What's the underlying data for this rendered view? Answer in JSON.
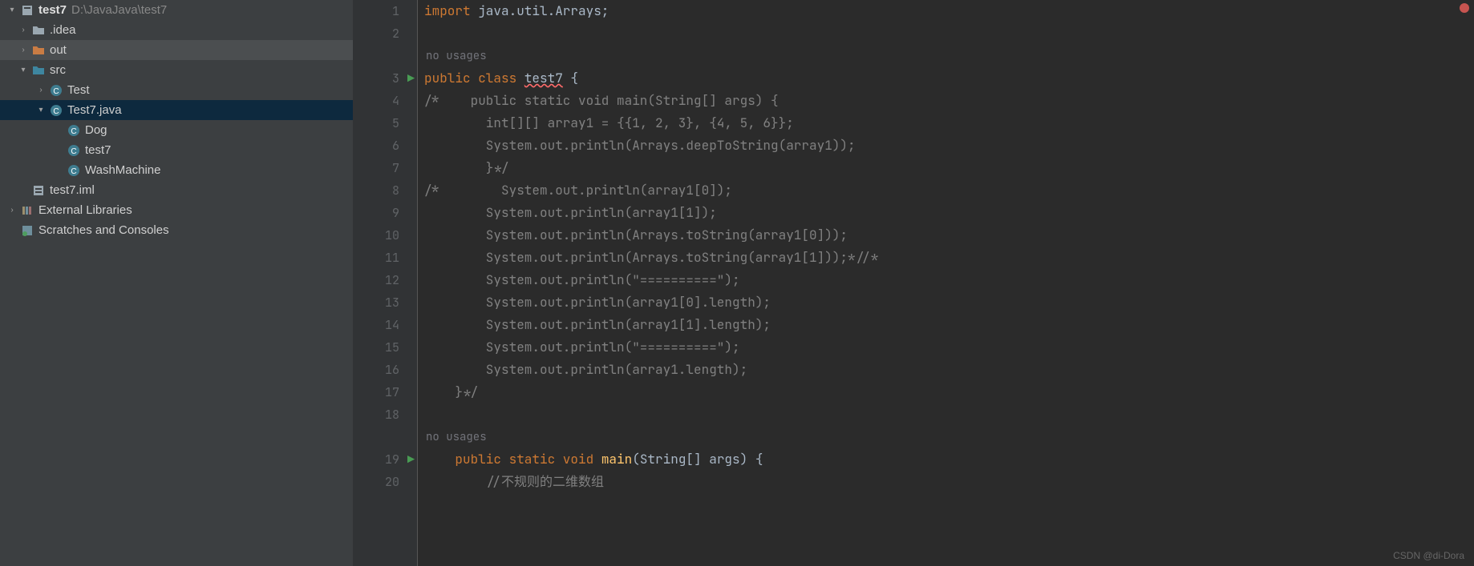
{
  "project": {
    "name": "test7",
    "path": "D:\\JavaJava\\test7",
    "tree": [
      {
        "indent": 0,
        "arrow": ">",
        "icon": "folder",
        "label": ".idea"
      },
      {
        "indent": 0,
        "arrow": ">",
        "icon": "folder-out",
        "label": "out",
        "highlighted": true
      },
      {
        "indent": 0,
        "arrow": "v",
        "icon": "folder-src",
        "label": "src",
        "err": true
      },
      {
        "indent": 1,
        "arrow": ">",
        "icon": "class",
        "label": "Test"
      },
      {
        "indent": 1,
        "arrow": "v",
        "icon": "class",
        "label": "Test7.java",
        "selected": true
      },
      {
        "indent": 2,
        "arrow": "",
        "icon": "class",
        "label": "Dog",
        "err": true
      },
      {
        "indent": 2,
        "arrow": "",
        "icon": "class",
        "label": "test7"
      },
      {
        "indent": 2,
        "arrow": "",
        "icon": "class",
        "label": "WashMachine",
        "err": true
      },
      {
        "indent": 0,
        "arrow": "",
        "icon": "iml",
        "label": "test7.iml"
      }
    ],
    "external": "External Libraries",
    "scratches": "Scratches and Consoles"
  },
  "hints": {
    "no_usages_1": "no usages",
    "no_usages_2": "no usages"
  },
  "code": {
    "lines": [
      {
        "n": 1,
        "tokens": [
          {
            "t": "import ",
            "c": "kw"
          },
          {
            "t": "java.util.Arrays;",
            "c": ""
          }
        ]
      },
      {
        "n": 2,
        "tokens": []
      },
      {
        "hint": "no_usages_1"
      },
      {
        "n": 3,
        "run": true,
        "tokens": [
          {
            "t": "public class ",
            "c": "kw"
          },
          {
            "t": "test7",
            "c": "err2"
          },
          {
            "t": " {",
            "c": ""
          }
        ]
      },
      {
        "n": 4,
        "tokens": [
          {
            "t": "/*    public static void main(String[] args) {",
            "c": "com"
          }
        ]
      },
      {
        "n": 5,
        "tokens": [
          {
            "t": "        int[][] array1 = {{1, 2, 3}, {4, 5, 6}};",
            "c": "com"
          }
        ]
      },
      {
        "n": 6,
        "tokens": [
          {
            "t": "        System.out.println(Arrays.deepToString(array1));",
            "c": "com"
          }
        ]
      },
      {
        "n": 7,
        "tokens": [
          {
            "t": "        }*/",
            "c": "com"
          }
        ]
      },
      {
        "n": 8,
        "tokens": [
          {
            "t": "/*        System.out.println(array1[0]);",
            "c": "com"
          }
        ]
      },
      {
        "n": 9,
        "tokens": [
          {
            "t": "        System.out.println(array1[1]);",
            "c": "com"
          }
        ]
      },
      {
        "n": 10,
        "tokens": [
          {
            "t": "        System.out.println(Arrays.toString(array1[0]));",
            "c": "com"
          }
        ]
      },
      {
        "n": 11,
        "tokens": [
          {
            "t": "        System.out.println(Arrays.toString(array1[1]));*//*",
            "c": "com"
          }
        ]
      },
      {
        "n": 12,
        "tokens": [
          {
            "t": "        System.out.println(\"==========\");",
            "c": "com"
          }
        ]
      },
      {
        "n": 13,
        "tokens": [
          {
            "t": "        System.out.println(array1[0].length);",
            "c": "com"
          }
        ]
      },
      {
        "n": 14,
        "tokens": [
          {
            "t": "        System.out.println(array1[1].length);",
            "c": "com"
          }
        ]
      },
      {
        "n": 15,
        "tokens": [
          {
            "t": "        System.out.println(\"==========\");",
            "c": "com"
          }
        ]
      },
      {
        "n": 16,
        "tokens": [
          {
            "t": "        System.out.println(array1.length);",
            "c": "com"
          }
        ]
      },
      {
        "n": 17,
        "tokens": [
          {
            "t": "    }*/",
            "c": "com"
          }
        ]
      },
      {
        "n": 18,
        "tokens": []
      },
      {
        "hint": "no_usages_2"
      },
      {
        "n": 19,
        "run": true,
        "tokens": [
          {
            "t": "    ",
            "c": ""
          },
          {
            "t": "public static void ",
            "c": "kw"
          },
          {
            "t": "main",
            "c": "fn"
          },
          {
            "t": "(String[] args) {",
            "c": ""
          }
        ]
      },
      {
        "n": 20,
        "tokens": [
          {
            "t": "        //不规则的二维数组",
            "c": "com"
          }
        ]
      }
    ]
  },
  "watermark": "CSDN @di-Dora"
}
